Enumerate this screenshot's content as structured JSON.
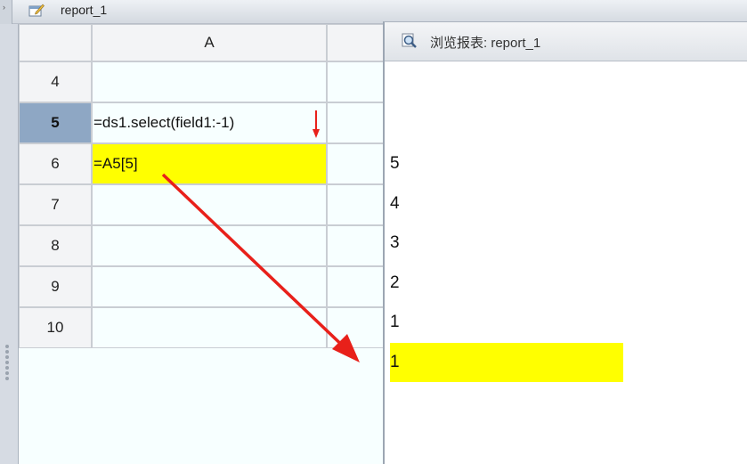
{
  "editor": {
    "title": "report_1",
    "column_header": "A",
    "rows": [
      {
        "row": "4",
        "cell": "",
        "active": false,
        "highlight": false
      },
      {
        "row": "5",
        "cell": "=ds1.select(field1:-1)",
        "active": true,
        "highlight": false
      },
      {
        "row": "6",
        "cell": "=A5[5]",
        "active": false,
        "highlight": true
      },
      {
        "row": "7",
        "cell": "",
        "active": false,
        "highlight": false
      },
      {
        "row": "8",
        "cell": "",
        "active": false,
        "highlight": false
      },
      {
        "row": "9",
        "cell": "",
        "active": false,
        "highlight": false
      },
      {
        "row": "10",
        "cell": "",
        "active": false,
        "highlight": false
      }
    ]
  },
  "preview": {
    "title": "浏览报表: report_1",
    "values": [
      "5",
      "4",
      "3",
      "2",
      "1",
      "1"
    ],
    "highlight_index": 5
  },
  "colors": {
    "highlight": "#ffff00",
    "active_row_header": "#8ea7c4",
    "arrow": "#e8201a"
  },
  "icons": [
    "edit-file-icon",
    "magnifier-icon",
    "down-arrow-icon",
    "diagonal-arrow"
  ]
}
